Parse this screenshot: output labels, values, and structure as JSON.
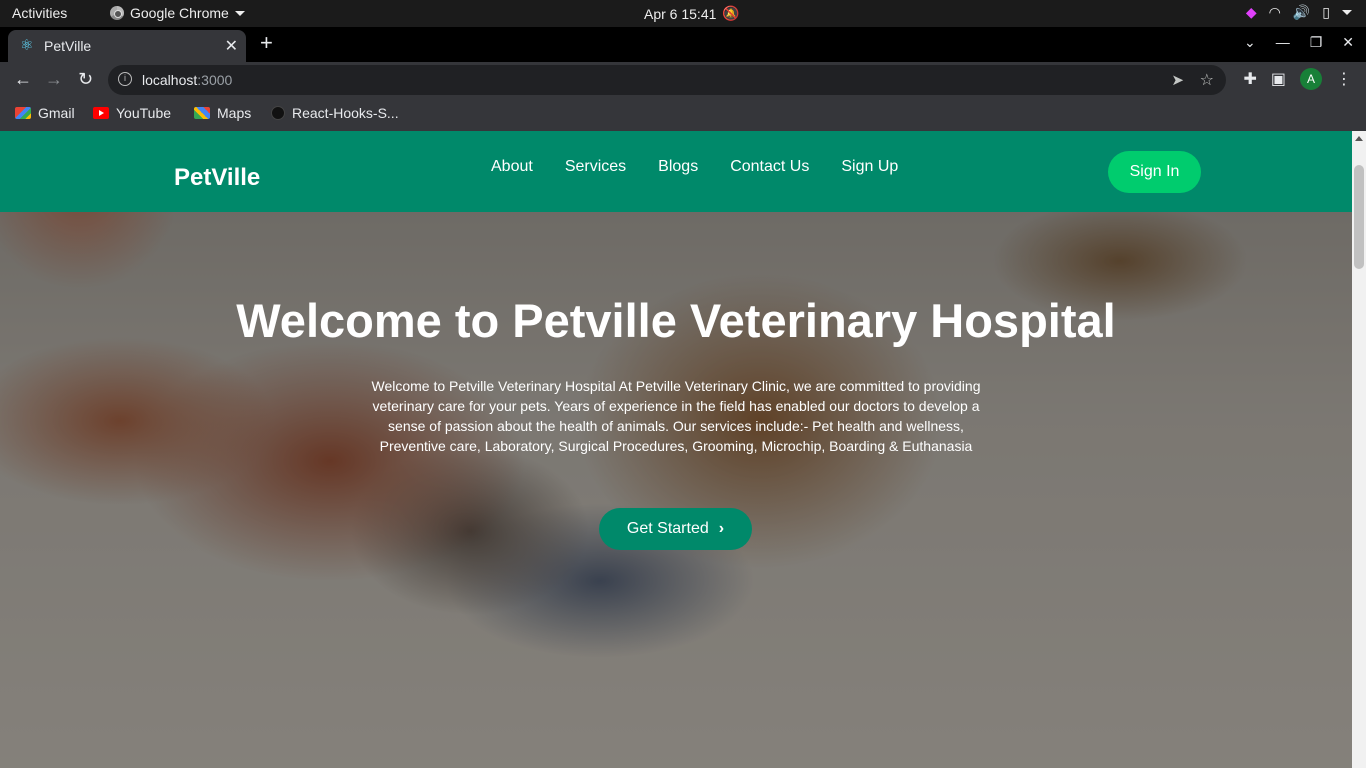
{
  "os_bar": {
    "activities": "Activities",
    "app_name": "Google Chrome",
    "clock": "Apr 6  15:41"
  },
  "browser": {
    "tab_title": "PetVille",
    "tab_close": "✕",
    "new_tab": "+",
    "url_host": "localhost",
    "url_port": ":3000",
    "profile_initial": "A",
    "bookmarks": [
      {
        "label": "Gmail",
        "icon": "gmail-icon"
      },
      {
        "label": "YouTube",
        "icon": "youtube-icon"
      },
      {
        "label": "Maps",
        "icon": "maps-icon"
      },
      {
        "label": "React-Hooks-S...",
        "icon": "github-icon"
      }
    ]
  },
  "site": {
    "brand": "PetVille",
    "nav": [
      "About",
      "Services",
      "Blogs",
      "Contact Us",
      "Sign Up"
    ],
    "sign_in": "Sign In",
    "hero_title": "Welcome to Petville Veterinary Hospital",
    "hero_text": "Welcome to Petville Veterinary Hospital At Petville Veterinary Clinic, we are committed to providing veterinary care for your pets. Years of experience in the field has enabled our doctors to develop a sense of passion about the health of animals. Our services include:- Pet health and wellness, Preventive care, Laboratory, Surgical Procedures, Grooming, Microchip, Boarding & Euthanasia",
    "cta": "Get Started",
    "colors": {
      "navbar": "#00896a",
      "sign_in": "#00cc6e",
      "cta": "#00896a"
    }
  }
}
